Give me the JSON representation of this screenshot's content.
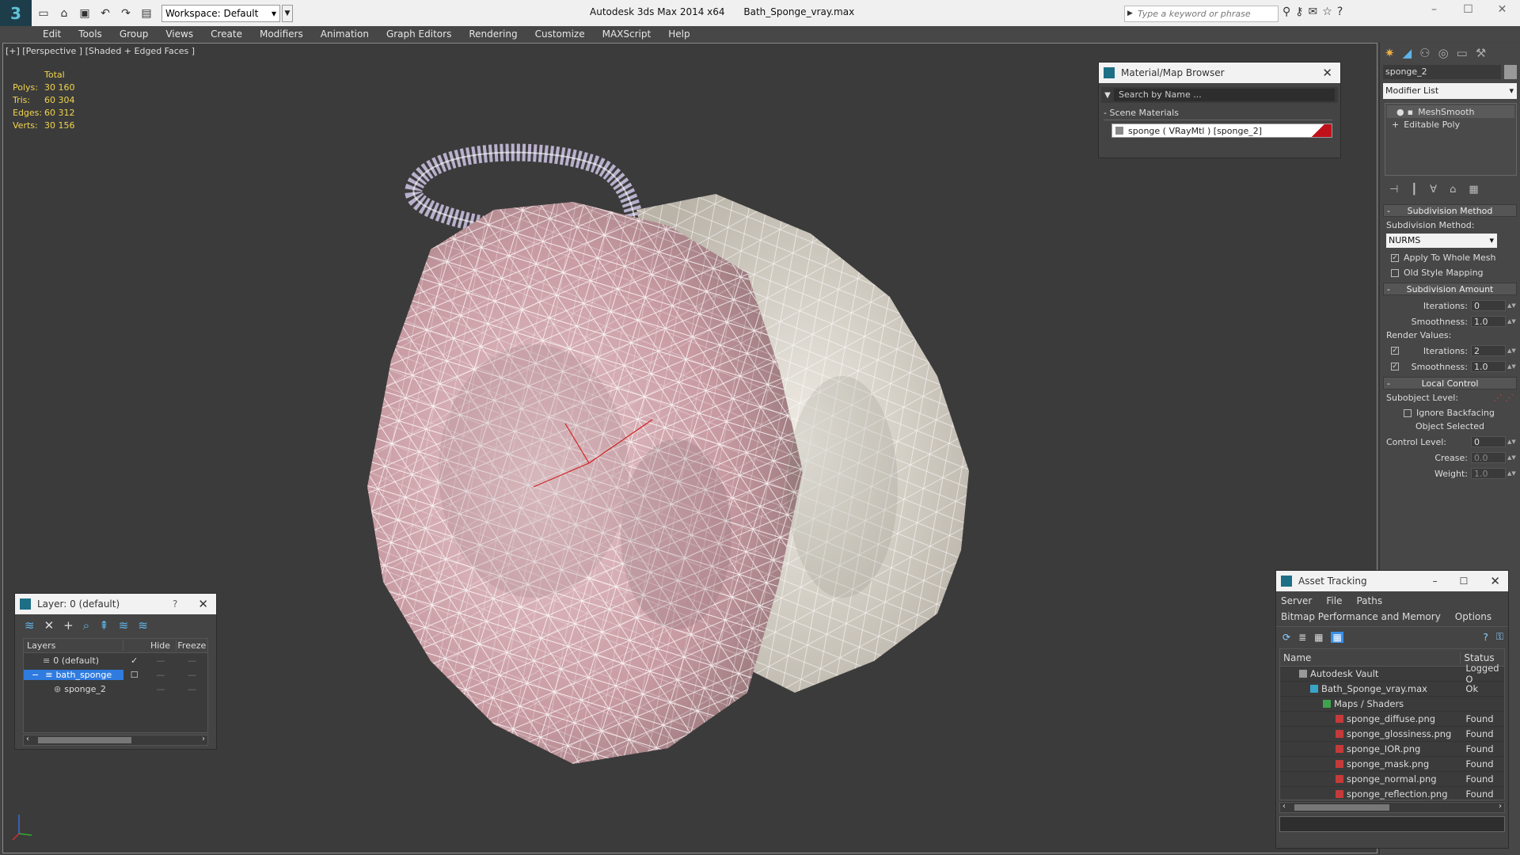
{
  "titlebar": {
    "workspace_label": "Workspace: Default",
    "app_title": "Autodesk 3ds Max  2014 x64",
    "file_title": "Bath_Sponge_vray.max",
    "search_placeholder": "Type a keyword or phrase"
  },
  "menu": [
    "Edit",
    "Tools",
    "Group",
    "Views",
    "Create",
    "Modifiers",
    "Animation",
    "Graph Editors",
    "Rendering",
    "Customize",
    "MAXScript",
    "Help"
  ],
  "viewport": {
    "label": "[+] [Perspective ] [Shaded + Edged Faces ]",
    "stats": {
      "header": "Total",
      "rows": [
        {
          "k": "Polys:",
          "v": "30 160"
        },
        {
          "k": "Tris:",
          "v": "60 304"
        },
        {
          "k": "Edges:",
          "v": "60 312"
        },
        {
          "k": "Verts:",
          "v": "30 156"
        }
      ]
    }
  },
  "material_browser": {
    "title": "Material/Map Browser",
    "search_placeholder": "Search by Name ...",
    "section": "Scene Materials",
    "material": "sponge  ( VRayMtl )  [sponge_2]"
  },
  "layer_panel": {
    "title": "Layer: 0 (default)",
    "help": "?",
    "headers": [
      "Layers",
      "Hide",
      "Freeze"
    ],
    "rows": [
      "0 (default)",
      "bath_sponge",
      "sponge_2"
    ]
  },
  "command_panel": {
    "object_name": "sponge_2",
    "modifier_list": "Modifier List",
    "stack": [
      "MeshSmooth",
      "Editable Poly"
    ],
    "subdivision_method": {
      "title": "Subdivision Method",
      "label": "Subdivision Method:",
      "value": "NURMS",
      "apply_whole_mesh": "Apply To Whole Mesh",
      "old_style_mapping": "Old Style Mapping"
    },
    "subdivision_amount": {
      "title": "Subdivision Amount",
      "iterations_label": "Iterations:",
      "iterations": "0",
      "smoothness_label": "Smoothness:",
      "smoothness": "1.0",
      "render_values": "Render Values:",
      "r_iterations": "2",
      "r_smoothness": "1.0"
    },
    "local_control": {
      "title": "Local Control",
      "subobject_level": "Subobject Level:",
      "ignore_backfacing": "Ignore Backfacing",
      "object_selected": "Object Selected",
      "control_level_label": "Control Level:",
      "control_level": "0",
      "crease_label": "Crease:",
      "crease": "0.0",
      "weight_label": "Weight:",
      "weight": "1.0"
    }
  },
  "asset_tracking": {
    "title": "Asset Tracking",
    "menu1": [
      "Server",
      "File",
      "Paths"
    ],
    "menu2": [
      "Bitmap Performance and Memory",
      "Options"
    ],
    "headers": [
      "Name",
      "Status"
    ],
    "rows": [
      {
        "name": "Autodesk Vault",
        "status": "Logged O"
      },
      {
        "name": "Bath_Sponge_vray.max",
        "status": "Ok"
      },
      {
        "name": "Maps / Shaders",
        "status": ""
      },
      {
        "name": "sponge_diffuse.png",
        "status": "Found"
      },
      {
        "name": "sponge_glossiness.png",
        "status": "Found"
      },
      {
        "name": "sponge_IOR.png",
        "status": "Found"
      },
      {
        "name": "sponge_mask.png",
        "status": "Found"
      },
      {
        "name": "sponge_normal.png",
        "status": "Found"
      },
      {
        "name": "sponge_reflection.png",
        "status": "Found"
      }
    ]
  }
}
